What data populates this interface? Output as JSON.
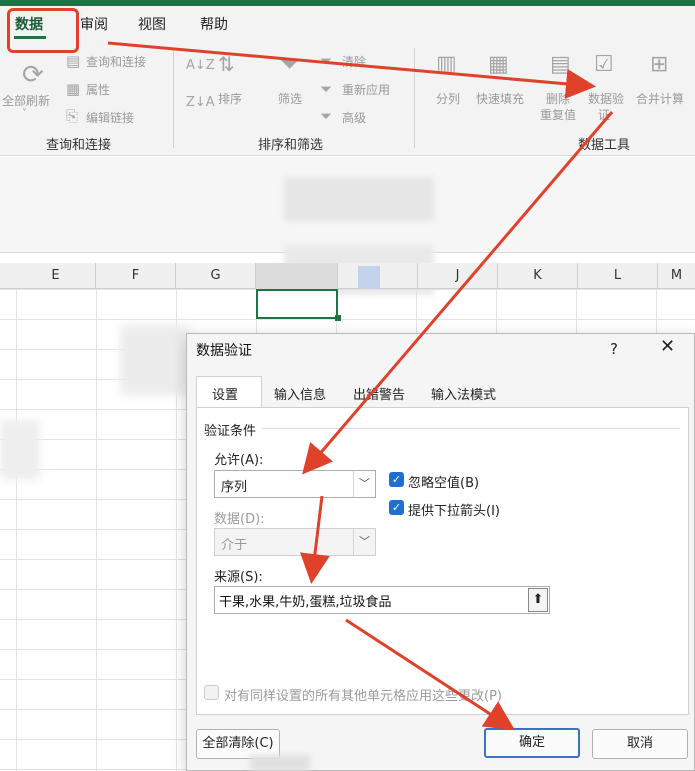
{
  "ribbon": {
    "tabs": [
      {
        "label": "数据",
        "active": true
      },
      {
        "label": "审阅",
        "active": false
      },
      {
        "label": "视图",
        "active": false
      },
      {
        "label": "帮助",
        "active": false
      }
    ],
    "query_group": {
      "refresh_all": "全部刷新",
      "query_connections": "查询和连接",
      "properties": "属性",
      "edit_links": "编辑链接",
      "group_label": "查询和连接"
    },
    "sort_group": {
      "sort": "排序",
      "filter": "筛选",
      "clear": "清除",
      "reapply": "重新应用",
      "advanced": "高级",
      "group_label": "排序和筛选"
    },
    "tools_group": {
      "text_to_columns": "分列",
      "flash_fill": "快速填充",
      "remove_duplicates_1": "删除",
      "remove_duplicates_2": "重复值",
      "data_validation_1": "数据验",
      "data_validation_2": "证",
      "consolidate": "合并计算",
      "group_label": "数据工具"
    }
  },
  "sheet": {
    "columns": [
      "E",
      "F",
      "G",
      "H",
      "I",
      "J",
      "K",
      "L",
      "M"
    ]
  },
  "dialog": {
    "title": "数据验证",
    "help": "?",
    "close": "✕",
    "tabs": [
      "设置",
      "输入信息",
      "出错警告",
      "输入法模式"
    ],
    "section": "验证条件",
    "allow_label": "允许(A):",
    "allow_value": "序列",
    "ignore_blank": "忽略空值(B)",
    "in_cell_dropdown": "提供下拉箭头(I)",
    "data_label": "数据(D):",
    "data_value": "介于",
    "source_label": "来源(S):",
    "source_value": "干果,水果,牛奶,蛋糕,垃圾食品",
    "apply_all": "对有同样设置的所有其他单元格应用这些更改(P)",
    "clear_all": "全部清除(C)",
    "ok": "确定",
    "cancel": "取消"
  },
  "colors": {
    "excel_green": "#217346",
    "annotation_red": "#e0412b",
    "checkbox_blue": "#1f6fd1"
  }
}
